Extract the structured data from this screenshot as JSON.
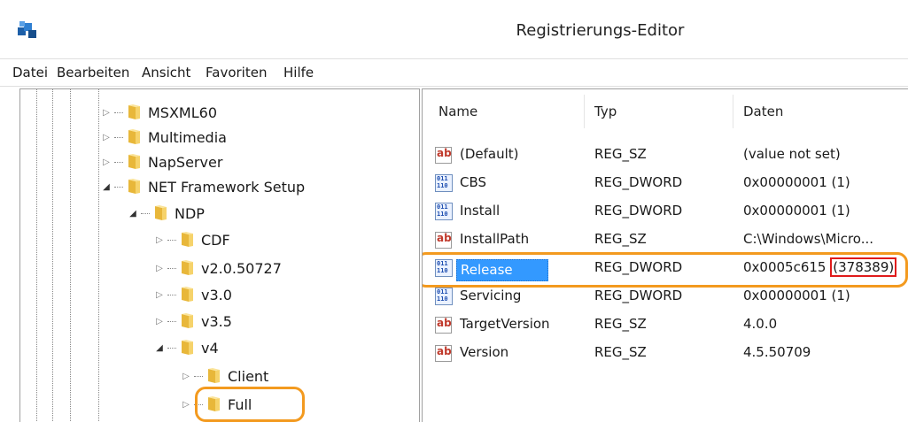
{
  "window": {
    "title": "Registrierungs-Editor"
  },
  "menu": [
    "Datei",
    "Bearbeiten",
    "Ansicht",
    "Favoriten",
    "Hilfe"
  ],
  "tree": {
    "nodes": [
      {
        "label": "MSXML60",
        "expanded": false
      },
      {
        "label": "Multimedia",
        "expanded": false
      },
      {
        "label": "NapServer",
        "expanded": false
      },
      {
        "label": "NET Framework Setup",
        "expanded": true
      },
      {
        "label": "NDP",
        "expanded": true
      },
      {
        "label": "CDF",
        "expanded": false
      },
      {
        "label": "v2.0.50727",
        "expanded": false
      },
      {
        "label": "v3.0",
        "expanded": false
      },
      {
        "label": "v3.5",
        "expanded": false
      },
      {
        "label": "v4",
        "expanded": true
      },
      {
        "label": "Client",
        "expanded": false
      },
      {
        "label": "Full",
        "expanded": false
      }
    ]
  },
  "list": {
    "columns": [
      "Name",
      "Typ",
      "Daten"
    ],
    "rows": [
      {
        "icon": "string-value-icon",
        "name": "(Default)",
        "type": "REG_SZ",
        "data": "(value not set)"
      },
      {
        "icon": "binary-value-icon",
        "name": "CBS",
        "type": "REG_DWORD",
        "data": "0x00000001 (1)"
      },
      {
        "icon": "binary-value-icon",
        "name": "Install",
        "type": "REG_DWORD",
        "data": "0x00000001 (1)"
      },
      {
        "icon": "string-value-icon",
        "name": "InstallPath",
        "type": "REG_SZ",
        "data": "C:\\Windows\\Micro..."
      },
      {
        "icon": "binary-value-icon",
        "name": "Release",
        "type": "REG_DWORD",
        "data_prefix": "0x0005c615 ",
        "data_highlight": "(378389)",
        "selected": true
      },
      {
        "icon": "binary-value-icon",
        "name": "Servicing",
        "type": "REG_DWORD",
        "data": "0x00000001 (1)"
      },
      {
        "icon": "string-value-icon",
        "name": "TargetVersion",
        "type": "REG_SZ",
        "data": "4.0.0"
      },
      {
        "icon": "string-value-icon",
        "name": "Version",
        "type": "REG_SZ",
        "data": "4.5.50709"
      }
    ]
  },
  "highlights": {
    "outline_color": "#f39a1f",
    "value_box_color": "#e01b1b",
    "selection_color": "#3399ff"
  },
  "string_icon_glyph": "ab",
  "binary_icon_glyph": "011\n110"
}
